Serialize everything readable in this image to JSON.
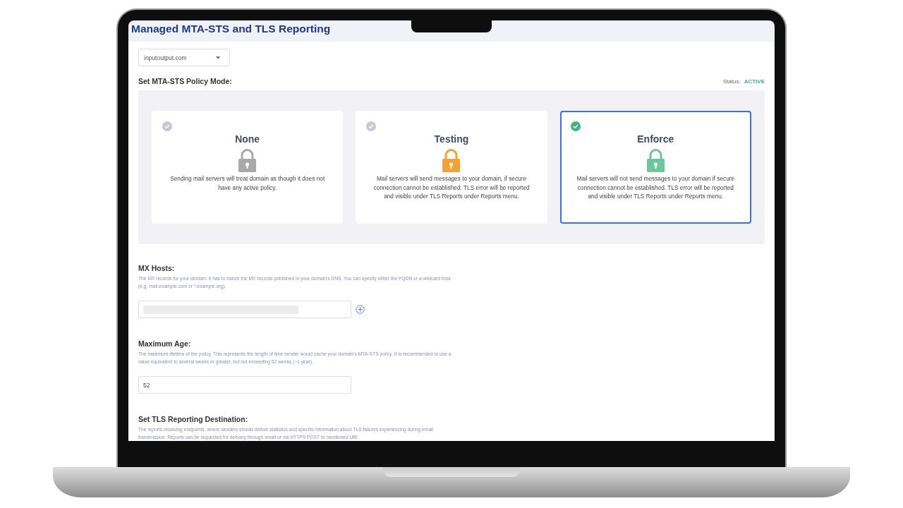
{
  "page": {
    "title": "Managed MTA-STS and TLS Reporting"
  },
  "domain_select": {
    "value": "inputoutput.com"
  },
  "policy_mode": {
    "label": "Set MTA-STS Policy Mode:",
    "status_label": "Status:",
    "status": "ACTIVE",
    "options": [
      {
        "title": "None",
        "description": "Sending mail servers will treat domain as though it does not have any active policy.",
        "color": "#a9a9a9",
        "selected": false
      },
      {
        "title": "Testing",
        "description": "Mail servers will send messages to your domain, if secure connection cannot be established. TLS error will be reported and visible under TLS Reports under Reports menu.",
        "color": "#f7a133",
        "selected": false
      },
      {
        "title": "Enforce",
        "description": "Mail servers will not send messages to your domain if secure connection cannot be established. TLS error will be reported and visible under TLS Reports under Reports menu.",
        "color": "#6cc79c",
        "selected": true
      }
    ]
  },
  "mx_hosts": {
    "label": "MX Hosts:",
    "help": "The MX records for your domain. It has to match the MX records published in your domain's DNS. You can specify either the FQDN or a wildcard host (e.g. mail.example.com or *.example.org)."
  },
  "maximum_age": {
    "label": "Maximum Age:",
    "help": "The maximum lifetime of the policy. This represents the length of time sender would cache your domain's MTA-STS policy. It is recommended to use a value equivalent to several weeks or greater, but not exceeding 52 weeks (~1 year).",
    "value": "52"
  },
  "tls_reporting": {
    "label": "Set TLS Reporting Destination:",
    "help": "The reports receiving endpoints, where senders should deliver statistics and specific information about TLS failures experiencing during email transmission. Reports can be requested for delivery through email or via HTTPS POST to mentioned URI"
  }
}
